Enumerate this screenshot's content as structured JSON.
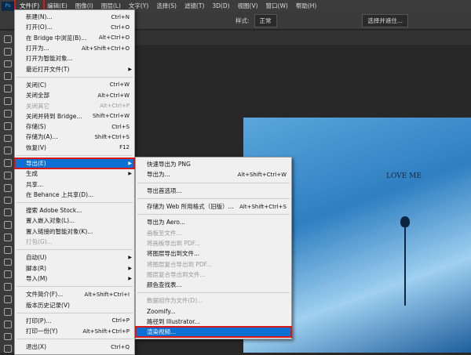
{
  "menubar": {
    "logo": "Ps",
    "items": [
      "文件(F)",
      "编辑(E)",
      "图像(I)",
      "图层(L)",
      "文字(Y)",
      "选择(S)",
      "滤镜(T)",
      "3D(D)",
      "视图(V)",
      "窗口(W)",
      "帮助(H)"
    ]
  },
  "options": {
    "style_label": "样式:",
    "style_value": "正常",
    "mask_button": "选择并遮住..."
  },
  "canvas": {
    "text": "LOVE ME"
  },
  "file_menu": [
    [
      {
        "label": "新建(N)...",
        "sc": "Ctrl+N"
      },
      {
        "label": "打开(O)...",
        "sc": "Ctrl+O"
      },
      {
        "label": "在 Bridge 中浏览(B)...",
        "sc": "Alt+Ctrl+O"
      },
      {
        "label": "打开为...",
        "sc": "Alt+Shift+Ctrl+O"
      },
      {
        "label": "打开为智能对象...",
        "sc": ""
      },
      {
        "label": "最近打开文件(T)",
        "sc": "",
        "sub": true
      }
    ],
    [
      {
        "label": "关闭(C)",
        "sc": "Ctrl+W"
      },
      {
        "label": "关闭全部",
        "sc": "Alt+Ctrl+W"
      },
      {
        "label": "关闭其它",
        "sc": "Alt+Ctrl+P",
        "dis": true
      },
      {
        "label": "关闭并转到 Bridge...",
        "sc": "Shift+Ctrl+W"
      },
      {
        "label": "存储(S)",
        "sc": "Ctrl+S"
      },
      {
        "label": "存储为(A)...",
        "sc": "Shift+Ctrl+S"
      },
      {
        "label": "恢复(V)",
        "sc": "F12"
      }
    ],
    [
      {
        "label": "导出(E)",
        "sc": "",
        "sub": true,
        "hl": true,
        "red": true
      },
      {
        "label": "生成",
        "sc": "",
        "sub": true
      },
      {
        "label": "共享...",
        "sc": ""
      },
      {
        "label": "在 Behance 上共享(D)...",
        "sc": ""
      }
    ],
    [
      {
        "label": "搜索 Adobe Stock...",
        "sc": ""
      },
      {
        "label": "置入嵌入对象(L)...",
        "sc": ""
      },
      {
        "label": "置入链接的智能对象(K)...",
        "sc": ""
      },
      {
        "label": "打包(G)...",
        "sc": "",
        "dis": true
      }
    ],
    [
      {
        "label": "自动(U)",
        "sc": "",
        "sub": true
      },
      {
        "label": "脚本(R)",
        "sc": "",
        "sub": true
      },
      {
        "label": "导入(M)",
        "sc": "",
        "sub": true
      }
    ],
    [
      {
        "label": "文件简介(F)...",
        "sc": "Alt+Shift+Ctrl+I"
      },
      {
        "label": "版本历史记录(V)",
        "sc": ""
      }
    ],
    [
      {
        "label": "打印(P)...",
        "sc": "Ctrl+P"
      },
      {
        "label": "打印一份(Y)",
        "sc": "Alt+Shift+Ctrl+P"
      }
    ],
    [
      {
        "label": "退出(X)",
        "sc": "Ctrl+Q"
      }
    ]
  ],
  "export_menu": [
    [
      {
        "label": "快速导出为 PNG",
        "sc": ""
      },
      {
        "label": "导出为...",
        "sc": "Alt+Shift+Ctrl+W"
      }
    ],
    [
      {
        "label": "导出首选项...",
        "sc": ""
      }
    ],
    [
      {
        "label": "存储为 Web 所用格式（旧版）...",
        "sc": "Alt+Shift+Ctrl+S"
      }
    ],
    [
      {
        "label": "导出为 Aero...",
        "sc": ""
      },
      {
        "label": "画板至文件...",
        "sc": "",
        "dis": true
      },
      {
        "label": "将画板导出到 PDF...",
        "sc": "",
        "dis": true
      },
      {
        "label": "将图层导出到文件...",
        "sc": ""
      },
      {
        "label": "将图层复合导出到 PDF...",
        "sc": "",
        "dis": true
      },
      {
        "label": "图层复合导出到文件...",
        "sc": "",
        "dis": true
      },
      {
        "label": "颜色查找表...",
        "sc": ""
      }
    ],
    [
      {
        "label": "数据组作为文件(D)...",
        "sc": "",
        "dis": true
      },
      {
        "label": "Zoomify...",
        "sc": ""
      },
      {
        "label": "路径到 Illustrator...",
        "sc": ""
      },
      {
        "label": "渲染视频...",
        "sc": "",
        "hl": true,
        "red": true
      }
    ]
  ]
}
